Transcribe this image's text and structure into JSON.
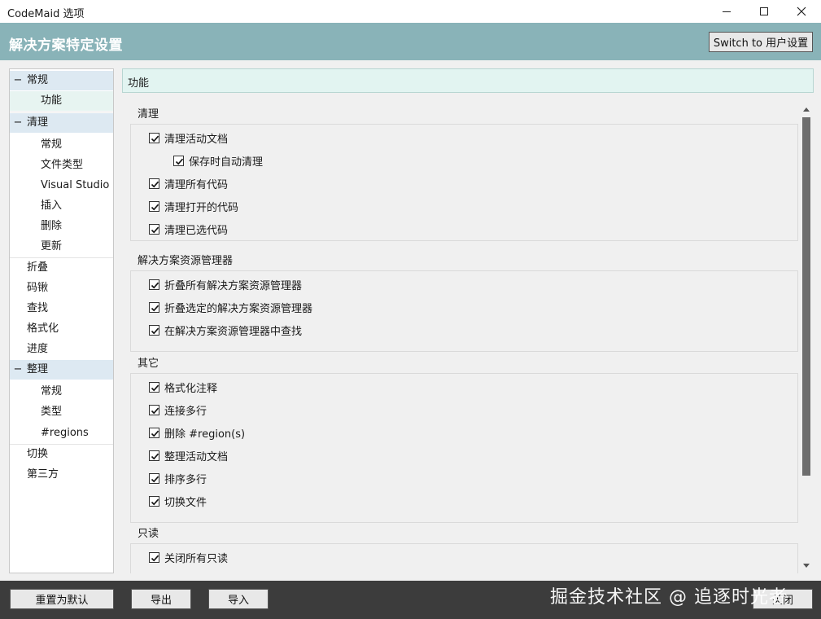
{
  "window": {
    "title": "CodeMaid 选项"
  },
  "header": {
    "title": "解决方案特定设置",
    "switch_label": "Switch to 用户设置"
  },
  "tree": {
    "items": [
      {
        "label": "常规",
        "expander": "−"
      },
      {
        "label": "功能"
      },
      {
        "label": "清理",
        "expander": "−"
      },
      {
        "label": "常规"
      },
      {
        "label": "文件类型"
      },
      {
        "label": "Visual Studio"
      },
      {
        "label": "插入"
      },
      {
        "label": "删除"
      },
      {
        "label": "更新"
      },
      {
        "label": "折叠"
      },
      {
        "label": "码锹"
      },
      {
        "label": "查找"
      },
      {
        "label": "格式化"
      },
      {
        "label": "进度"
      },
      {
        "label": "整理",
        "expander": "−"
      },
      {
        "label": "常规"
      },
      {
        "label": "类型"
      },
      {
        "label": "#regions"
      },
      {
        "label": "切换"
      },
      {
        "label": "第三方"
      }
    ]
  },
  "breadcrumb": "功能",
  "groups": {
    "cleanup": {
      "title": "清理",
      "items": [
        {
          "label": "清理活动文档",
          "checked": true
        },
        {
          "label": "保存时自动清理",
          "checked": true
        },
        {
          "label": "清理所有代码",
          "checked": true
        },
        {
          "label": "清理打开的代码",
          "checked": true
        },
        {
          "label": "清理已选代码",
          "checked": true
        }
      ]
    },
    "solution_explorer": {
      "title": "解决方案资源管理器",
      "items": [
        {
          "label": "折叠所有解决方案资源管理器",
          "checked": true
        },
        {
          "label": "折叠选定的解决方案资源管理器",
          "checked": true
        },
        {
          "label": "在解决方案资源管理器中查找",
          "checked": true
        }
      ]
    },
    "other": {
      "title": "其它",
      "items": [
        {
          "label": "格式化注释",
          "checked": true
        },
        {
          "label": "连接多行",
          "checked": true
        },
        {
          "label": "删除 #region(s)",
          "checked": true
        },
        {
          "label": "整理活动文档",
          "checked": true
        },
        {
          "label": "排序多行",
          "checked": true
        },
        {
          "label": "切换文件",
          "checked": true
        }
      ]
    },
    "readonly": {
      "title": "只读",
      "items": [
        {
          "label": "关闭所有只读",
          "checked": true
        }
      ]
    }
  },
  "footer": {
    "reset_label": "重置为默认",
    "export_label": "导出",
    "import_label": "导入",
    "close_label": "关闭",
    "watermark": "掘金技术社区 @ 追逐时光者"
  },
  "icons": {
    "minimize": "minimize-icon",
    "maximize": "maximize-icon",
    "close": "close-icon",
    "check": "checkmark-icon",
    "scroll_up": "scroll-up-icon",
    "scroll_down": "scroll-down-icon"
  }
}
